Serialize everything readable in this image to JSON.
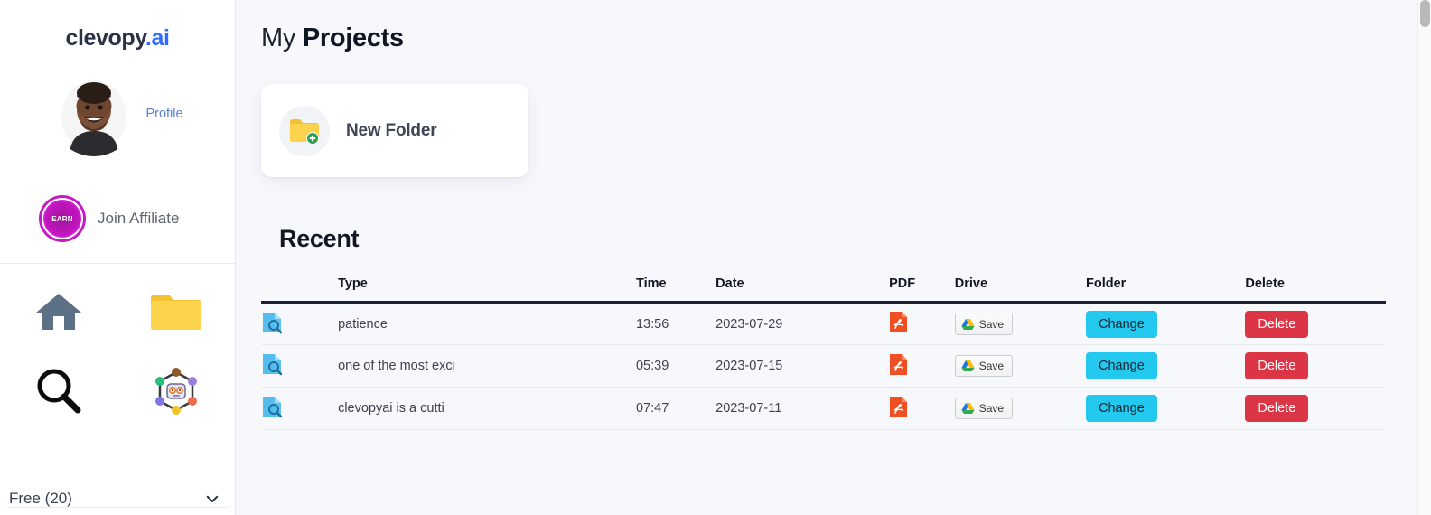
{
  "sidebar": {
    "brand": {
      "name": "clevopy",
      "suffix": ".ai"
    },
    "profile": {
      "link_label": "Profile",
      "avatar_icon": "user-avatar-photo"
    },
    "affiliate": {
      "badge_text": "EARN",
      "label": "Join Affiliate"
    },
    "nav_icons": [
      {
        "name": "home-icon",
        "label": "Home"
      },
      {
        "name": "folder-icon",
        "label": "Folders"
      },
      {
        "name": "search-icon",
        "label": "Search"
      },
      {
        "name": "bot-network-icon",
        "label": "Assistant"
      }
    ],
    "plan": {
      "label": "Free (20)",
      "chevron_icon": "chevron-down-icon"
    }
  },
  "main": {
    "title_light": "My",
    "title_bold": "Projects",
    "new_folder": {
      "label": "New Folder",
      "icon": "folder-add-icon"
    },
    "recent_heading": "Recent",
    "table": {
      "columns": [
        "",
        "Type",
        "Time",
        "Date",
        "PDF",
        "Drive",
        "Folder",
        "Delete"
      ],
      "rows": [
        {
          "file_icon": "document-search-icon",
          "type": "patience",
          "time": "13:56",
          "date": "2023-07-29",
          "pdf_icon": "pdf-file-icon",
          "drive_label": "Save",
          "folder_label": "Change",
          "delete_label": "Delete"
        },
        {
          "file_icon": "document-search-icon",
          "type": "one of the most exci",
          "time": "05:39",
          "date": "2023-07-15",
          "pdf_icon": "pdf-file-icon",
          "drive_label": "Save",
          "folder_label": "Change",
          "delete_label": "Delete"
        },
        {
          "file_icon": "document-search-icon",
          "type": "clevopyai is a cutti",
          "time": "07:47",
          "date": "2023-07-11",
          "pdf_icon": "pdf-file-icon",
          "drive_label": "Save",
          "folder_label": "Change",
          "delete_label": "Delete"
        }
      ]
    }
  },
  "colors": {
    "sidebar_bg": "#ffffff",
    "main_bg": "#f7f8fc",
    "accent_cyan": "#22c8ed",
    "danger_red": "#dc3545",
    "profile_link": "#5b7fd4",
    "affiliate_magenta": "#c41ac2",
    "heading_dark": "#111624"
  }
}
